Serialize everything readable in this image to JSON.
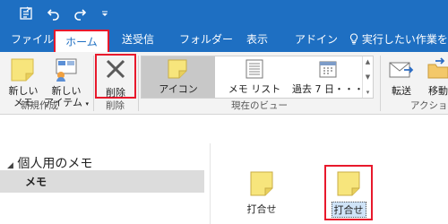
{
  "colors": {
    "accent": "#1e6fc2",
    "highlight": "#e8192c",
    "note_yellow": "#f7e57c"
  },
  "qat": {
    "icons": [
      "send-receive-icon",
      "undo-icon",
      "redo-icon",
      "customize-qat-icon"
    ]
  },
  "tabs": [
    {
      "label": "ファイル"
    },
    {
      "label": "ホーム"
    },
    {
      "label": "送受信"
    },
    {
      "label": "フォルダー"
    },
    {
      "label": "表示"
    },
    {
      "label": "アドイン"
    }
  ],
  "tell_me": "実行したい作業を入",
  "ribbon": {
    "new_group": {
      "label": "新規作成",
      "new_note": {
        "line1": "新しい",
        "line2": "メモ"
      },
      "new_items": {
        "line1": "新しい",
        "line2": "アイテム"
      }
    },
    "delete_group": {
      "label": "削除",
      "delete_button": "削除"
    },
    "view_group": {
      "label": "現在のビュー",
      "items": [
        "アイコン",
        "メモ リスト",
        "過去 7 日・・・"
      ],
      "selected": "アイコン"
    },
    "action_group": {
      "label": "アクション",
      "forward": "転送",
      "move": "移動"
    }
  },
  "nav": {
    "header": "個人用のメモ",
    "item": "メモ"
  },
  "notes": [
    {
      "label": "打合せ",
      "selected": false
    },
    {
      "label": "打合せ",
      "selected": true
    }
  ]
}
